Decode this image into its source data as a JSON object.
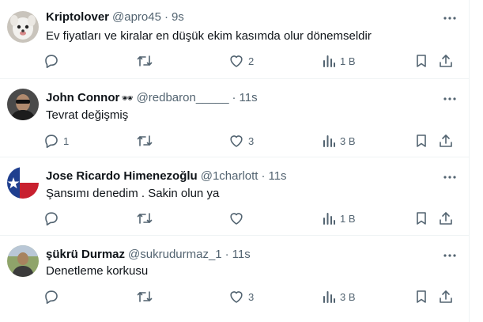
{
  "colors": {
    "text": "#0f1419",
    "muted": "#536471",
    "divider": "#eff3f4"
  },
  "icons": {
    "reply": "reply-icon",
    "retweet": "retweet-icon",
    "like": "heart-icon",
    "views": "views-icon",
    "bookmark": "bookmark-icon",
    "share": "share-icon",
    "more": "more-icon"
  },
  "tweets": [
    {
      "name": "Kriptolover",
      "handle": "@apro45",
      "time": "9s",
      "text": "Ev fiyatları ve kiralar en düşük ekim kasımda olur dönemseldir",
      "replies": "",
      "retweets": "",
      "likes": "2",
      "views": "1 B"
    },
    {
      "name": "John Connor",
      "name_emoji": "🕶",
      "handle": "@redbaron_____",
      "time": "11s",
      "text": "Tevrat değişmiş",
      "replies": "1",
      "retweets": "",
      "likes": "3",
      "views": "3 B"
    },
    {
      "name": "Jose Ricardo Himenezoğlu",
      "handle": "@1charlott",
      "time": "11s",
      "text": "Şansımı denedim . Sakin olun ya",
      "replies": "",
      "retweets": "",
      "likes": "",
      "views": "1 B"
    },
    {
      "name": "şükrü Durmaz",
      "handle": "@sukrudurmaz_1",
      "time": "11s",
      "text": "Denetleme korkusu",
      "replies": "",
      "retweets": "",
      "likes": "3",
      "views": "3 B"
    }
  ]
}
